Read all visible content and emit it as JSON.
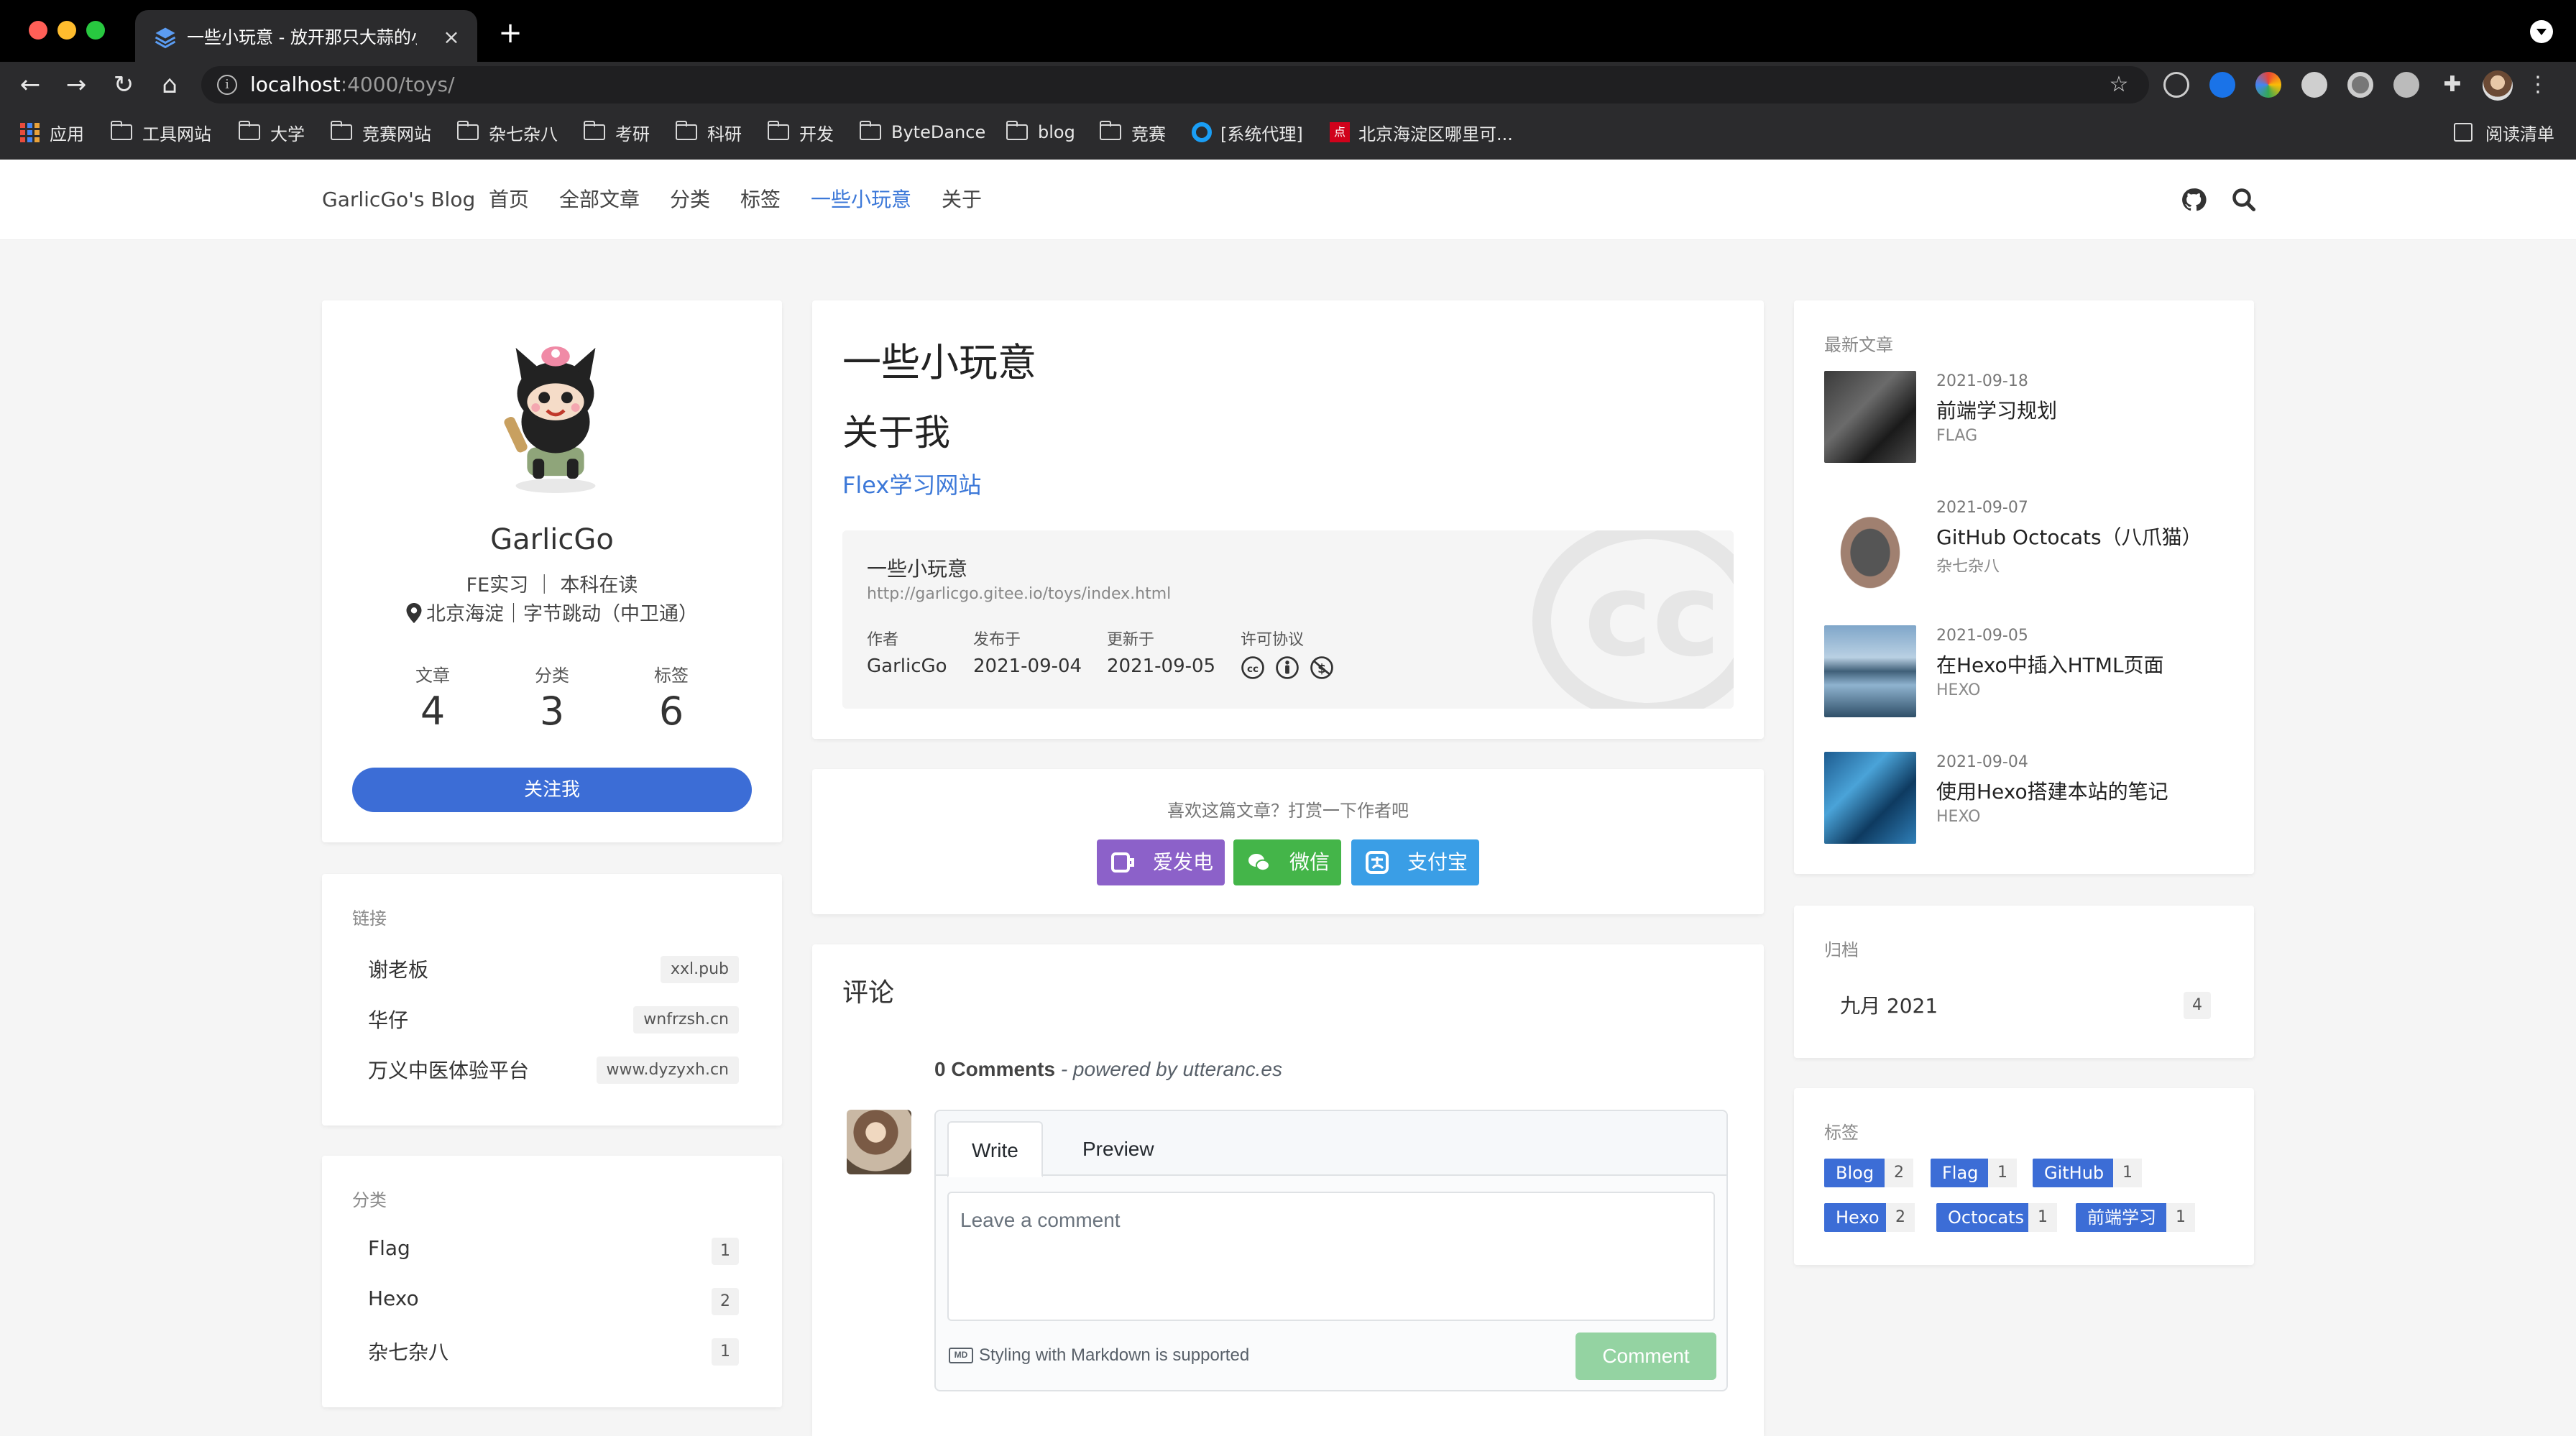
{
  "browser": {
    "tab_title": "一些小玩意 - 放开那只大蒜的小站",
    "tab_close": "×",
    "new_tab": "+",
    "url_host": "localhost",
    "url_path": ":4000/toys/",
    "bookmarks": [
      "应用",
      "工具网站",
      "大学",
      "竞赛网站",
      "杂七杂八",
      "考研",
      "科研",
      "开发",
      "ByteDance",
      "blog",
      "竞赛",
      "[系统代理]",
      "北京海淀区哪里可..."
    ],
    "reading_list": "阅读清单"
  },
  "nav": {
    "brand": "GarlicGo's Blog",
    "links": [
      "首页",
      "全部文章",
      "分类",
      "标签",
      "一些小玩意",
      "关于"
    ]
  },
  "profile": {
    "name": "GarlicGo",
    "bio": "FE实习 ｜ 本科在读",
    "location": "北京海淀｜字节跳动（中卫通）",
    "stats": [
      {
        "label": "文章",
        "value": "4"
      },
      {
        "label": "分类",
        "value": "3"
      },
      {
        "label": "标签",
        "value": "6"
      }
    ],
    "follow": "关注我"
  },
  "links_card": {
    "title": "链接",
    "items": [
      {
        "name": "谢老板",
        "badge": "xxl.pub"
      },
      {
        "name": "华仔",
        "badge": "wnfrzsh.cn"
      },
      {
        "name": "万义中医体验平台",
        "badge": "www.dyzyxh.cn"
      }
    ]
  },
  "categories_card": {
    "title": "分类",
    "items": [
      {
        "name": "Flag",
        "count": "1"
      },
      {
        "name": "Hexo",
        "count": "2"
      },
      {
        "name": "杂七杂八",
        "count": "1"
      }
    ]
  },
  "article": {
    "title": "一些小玩意",
    "heading": "关于我",
    "link": "Flex学习网站",
    "license_box": {
      "title": "一些小玩意",
      "url": "http://garlicgo.gitee.io/toys/index.html",
      "author_label": "作者",
      "author": "GarlicGo",
      "published_label": "发布于",
      "published": "2021-09-04",
      "updated_label": "更新于",
      "updated": "2021-09-05",
      "license_label": "许可协议",
      "watermark": "cc"
    }
  },
  "donate": {
    "prompt": "喜欢这篇文章？打赏一下作者吧",
    "buttons": [
      {
        "label": "爱发电",
        "color": "#8c61c9"
      },
      {
        "label": "微信",
        "color": "#44b549"
      },
      {
        "label": "支付宝",
        "color": "#3a9ee6"
      }
    ]
  },
  "comments": {
    "title": "评论",
    "count_text": "0 Comments",
    "powered": " - powered by utteranc.es",
    "tab_write": "Write",
    "tab_preview": "Preview",
    "placeholder": "Leave a comment",
    "markdown_note": "Styling with Markdown is supported",
    "md_icon": "MD",
    "submit": "Comment"
  },
  "recent": {
    "title": "最新文章",
    "items": [
      {
        "date": "2021-09-18",
        "title": "前端学习规划",
        "category": "FLAG"
      },
      {
        "date": "2021-09-07",
        "title": "GitHub Octocats（八爪猫）",
        "category": "杂七杂八"
      },
      {
        "date": "2021-09-05",
        "title": "在Hexo中插入HTML页面",
        "category": "HEXO"
      },
      {
        "date": "2021-09-04",
        "title": "使用Hexo搭建本站的笔记",
        "category": "HEXO"
      }
    ]
  },
  "archive": {
    "title": "归档",
    "items": [
      {
        "name": "九月 2021",
        "count": "4"
      }
    ]
  },
  "tags": {
    "title": "标签",
    "items": [
      {
        "name": "Blog",
        "count": "2"
      },
      {
        "name": "Flag",
        "count": "1"
      },
      {
        "name": "GitHub",
        "count": "1"
      },
      {
        "name": "Hexo",
        "count": "2"
      },
      {
        "name": "Octocats",
        "count": "1"
      },
      {
        "name": "前端学习",
        "count": "1"
      }
    ]
  },
  "colors": {
    "accent": "#3c6dd6",
    "link": "#3c78d8",
    "comment_button": "#94d3a2"
  }
}
